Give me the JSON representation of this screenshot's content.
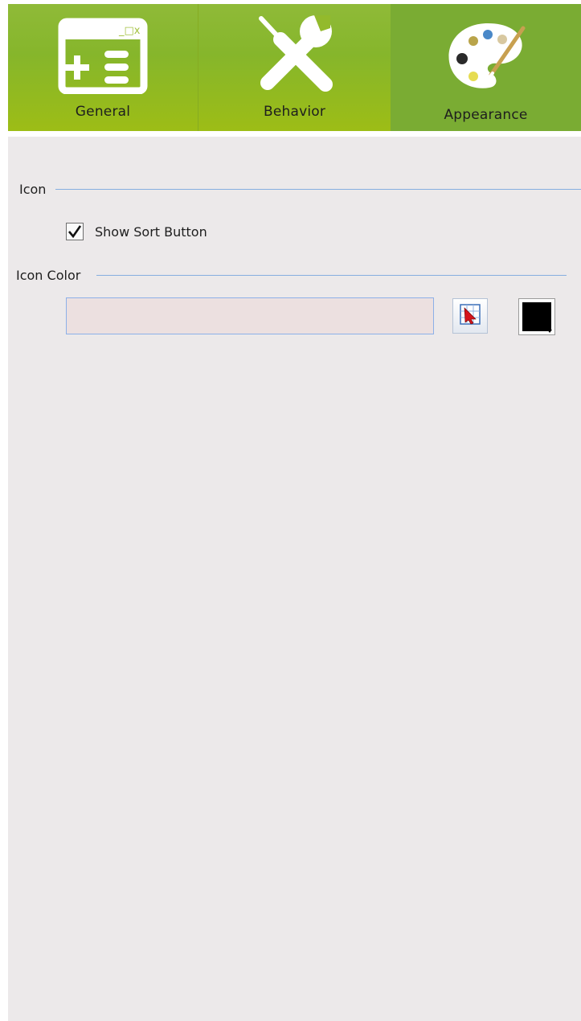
{
  "tabs": [
    {
      "label": "General",
      "icon": "window-plus-list-icon"
    },
    {
      "label": "Behavior",
      "icon": "screwdriver-wrench-icon"
    },
    {
      "label": "Appearance",
      "icon": "paint-palette-icon",
      "selected": true
    }
  ],
  "icon_group": {
    "title": "Icon",
    "show_sort_button": {
      "label": "Show Sort Button",
      "checked": true
    }
  },
  "icon_color_group": {
    "title": "Icon Color",
    "color_value": "",
    "picker_icon": "color-picker-icon",
    "swatch_color": "#000000"
  },
  "colors": {
    "tab_bar": "#8cb736",
    "tab_selected": "#7aac33",
    "panel_bg": "#ece9ea",
    "group_line": "#86aee0"
  }
}
